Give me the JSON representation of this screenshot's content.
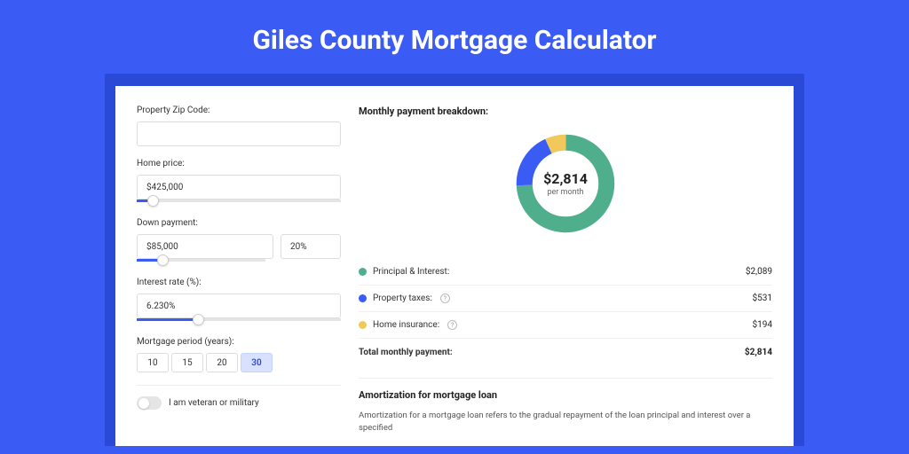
{
  "title": "Giles County Mortgage Calculator",
  "form": {
    "zip_label": "Property Zip Code:",
    "zip_value": "",
    "price_label": "Home price:",
    "price_value": "$425,000",
    "price_slider_pct": 8,
    "down_label": "Down payment:",
    "down_value": "$85,000",
    "down_pct_value": "20%",
    "down_slider_pct": 20,
    "rate_label": "Interest rate (%):",
    "rate_value": "6.230%",
    "rate_slider_pct": 30,
    "period_label": "Mortgage period (years):",
    "periods": [
      "10",
      "15",
      "20",
      "30"
    ],
    "period_active": 3,
    "veteran_label": "I am veteran or military"
  },
  "breakdown": {
    "title": "Monthly payment breakdown:",
    "center_amount": "$2,814",
    "center_sub": "per month",
    "rows": [
      {
        "color": "#4fae8c",
        "label": "Principal & Interest:",
        "value": "$2,089",
        "info": false
      },
      {
        "color": "#3a5cf5",
        "label": "Property taxes:",
        "value": "$531",
        "info": true
      },
      {
        "color": "#f1c95b",
        "label": "Home insurance:",
        "value": "$194",
        "info": true
      }
    ],
    "total_label": "Total monthly payment:",
    "total_value": "$2,814"
  },
  "chart_data": {
    "type": "pie",
    "title": "Monthly payment breakdown",
    "series": [
      {
        "name": "Principal & Interest",
        "value": 2089,
        "color": "#4fae8c"
      },
      {
        "name": "Property taxes",
        "value": 531,
        "color": "#3a5cf5"
      },
      {
        "name": "Home insurance",
        "value": 194,
        "color": "#f1c95b"
      }
    ],
    "total": 2814
  },
  "amort": {
    "title": "Amortization for mortgage loan",
    "text": "Amortization for a mortgage loan refers to the gradual repayment of the loan principal and interest over a specified"
  }
}
